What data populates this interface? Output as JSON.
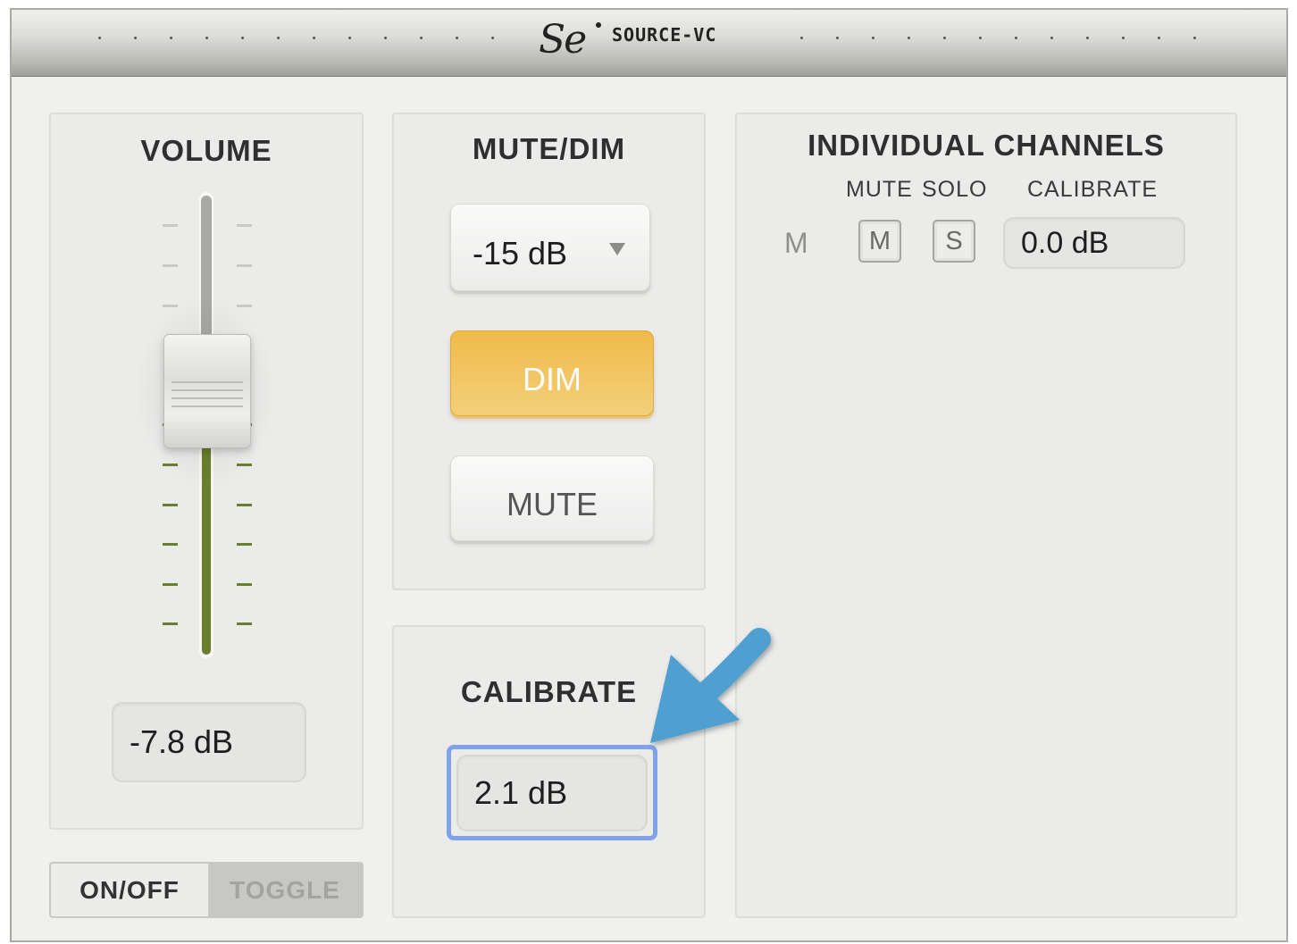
{
  "titlebar": {
    "brand": "SOURCE-VC",
    "logo_mark": "Se"
  },
  "volume": {
    "title": "VOLUME",
    "value": "-7.8 dB",
    "toggle_on_label": "ON/OFF",
    "toggle_label": "TOGGLE"
  },
  "mute_dim": {
    "title": "MUTE/DIM",
    "dim_amount": "-15 dB",
    "dim_label": "DIM",
    "mute_label": "MUTE"
  },
  "calibrate": {
    "title": "CALIBRATE",
    "value": "2.1 dB"
  },
  "channels": {
    "title": "INDIVIDUAL CHANNELS",
    "col_mute": "MUTE",
    "col_solo": "SOLO",
    "col_calibrate": "CALIBRATE",
    "rows": [
      {
        "label": "M",
        "mute": "M",
        "solo": "S",
        "calibrate": "0.0 dB"
      }
    ]
  },
  "colors": {
    "dim_active": "#f0bb4a",
    "fader_green": "#6a7f2e",
    "focus_ring": "#7fa2ea",
    "annotation_arrow": "#4f9fd0"
  }
}
